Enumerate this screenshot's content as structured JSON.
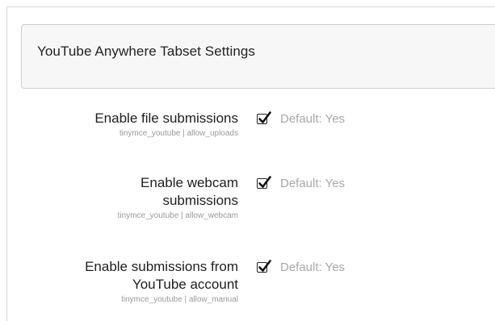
{
  "header": {
    "title": "YouTube Anywhere Tabset Settings"
  },
  "settings": [
    {
      "label_lines": [
        "Enable file submissions"
      ],
      "key": "tinymce_youtube | allow_uploads",
      "checked": true,
      "default_text": "Default: Yes"
    },
    {
      "label_lines": [
        "Enable webcam",
        "submissions"
      ],
      "key": "tinymce_youtube | allow_webcam",
      "checked": true,
      "default_text": "Default: Yes"
    },
    {
      "label_lines": [
        "Enable submissions from",
        "YouTube account"
      ],
      "key": "tinymce_youtube | allow_manual",
      "checked": true,
      "default_text": "Default: Yes"
    }
  ],
  "icons": {
    "checkmark": "checkmark-icon"
  }
}
